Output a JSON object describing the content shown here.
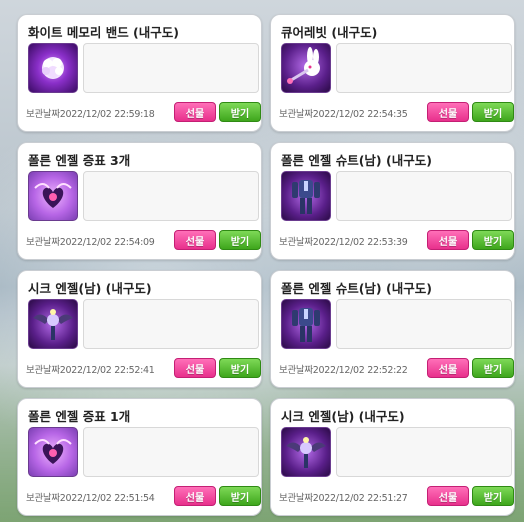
{
  "items": [
    {
      "title": "화이트 메모리 밴드 (내구도)",
      "date_label": "보관날짜",
      "date": "2022/12/02 22:59:18",
      "icon": "white-memory-band-icon",
      "gift_label": "선물",
      "receive_label": "받기"
    },
    {
      "title": "큐어레빗 (내구도)",
      "date_label": "보관날짜",
      "date": "2022/12/02 22:54:35",
      "icon": "cure-rabbit-icon",
      "gift_label": "선물",
      "receive_label": "받기"
    },
    {
      "title": "폴른 엔젤 증표 3개",
      "date_label": "보관날짜",
      "date": "2022/12/02 22:54:09",
      "icon": "fallen-angel-token-icon",
      "gift_label": "선물",
      "receive_label": "받기"
    },
    {
      "title": "폴른 엔젤 슈트(남) (내구도)",
      "date_label": "보관날짜",
      "date": "2022/12/02 22:53:39",
      "icon": "fallen-angel-suit-icon",
      "gift_label": "선물",
      "receive_label": "받기"
    },
    {
      "title": "시크 엔젤(남) (내구도)",
      "date_label": "보관날짜",
      "date": "2022/12/02 22:52:41",
      "icon": "chic-angel-icon",
      "gift_label": "선물",
      "receive_label": "받기"
    },
    {
      "title": "폴른 엔젤 슈트(남) (내구도)",
      "date_label": "보관날짜",
      "date": "2022/12/02 22:52:22",
      "icon": "fallen-angel-suit-icon",
      "gift_label": "선물",
      "receive_label": "받기"
    },
    {
      "title": "폴른 엔젤 증표 1개",
      "date_label": "보관날짜",
      "date": "2022/12/02 22:51:54",
      "icon": "fallen-angel-token-icon",
      "gift_label": "선물",
      "receive_label": "받기"
    },
    {
      "title": "시크 엔젤(남) (내구도)",
      "date_label": "보관날짜",
      "date": "2022/12/02 22:51:27",
      "icon": "chic-angel-icon",
      "gift_label": "선물",
      "receive_label": "받기"
    }
  ],
  "colors": {
    "gift": "#e8308c",
    "receive": "#3ea61c",
    "icon_bg": "#5a1f8a"
  }
}
